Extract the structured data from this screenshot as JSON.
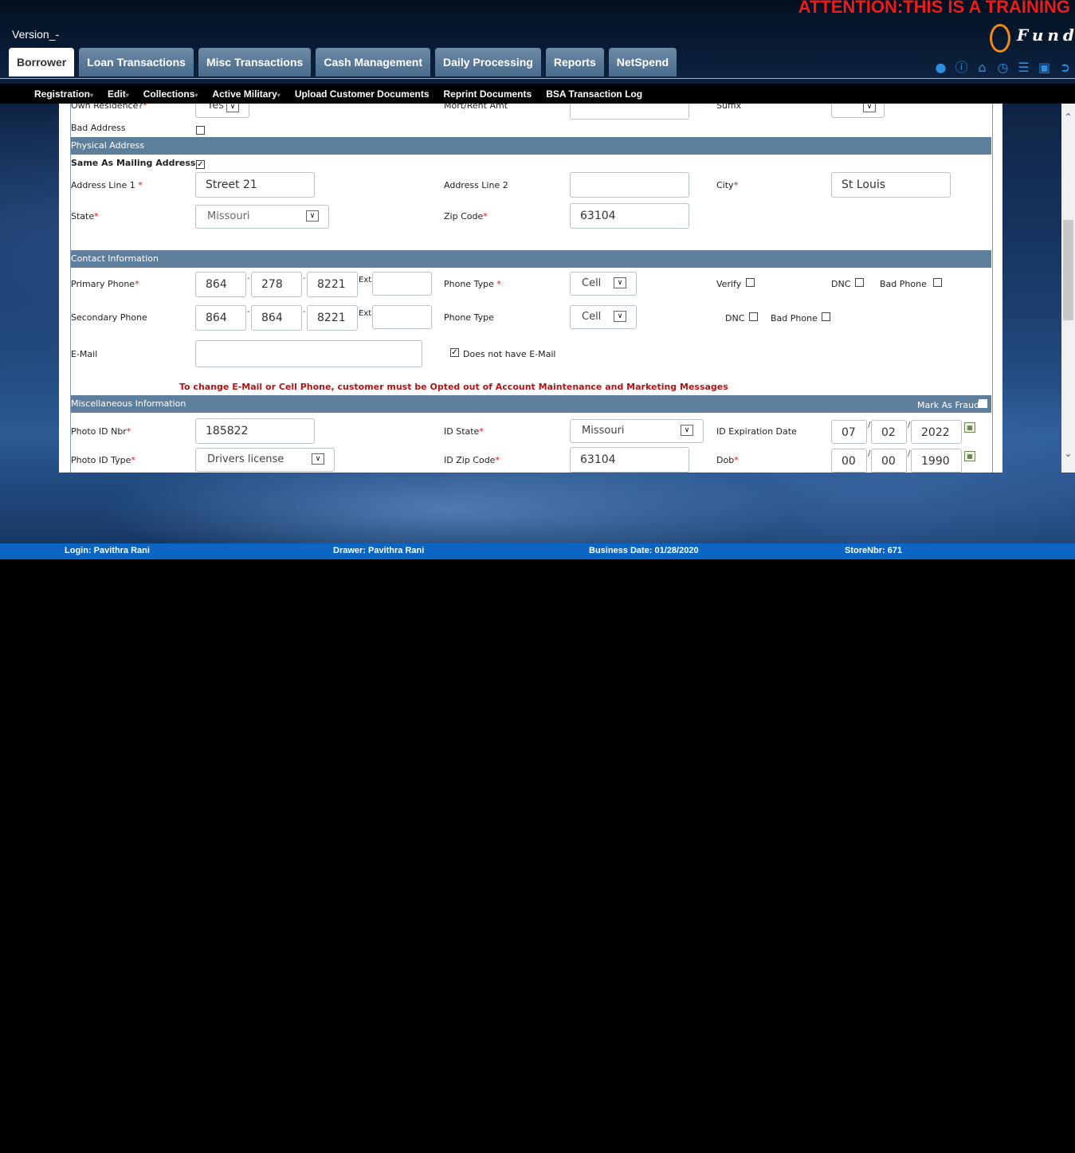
{
  "header": {
    "attention": "ATTENTION:THIS IS A TRAINING",
    "version": "Version_-",
    "logo_text": "Fund",
    "tabs": [
      "Borrower",
      "Loan Transactions",
      "Misc Transactions",
      "Cash Management",
      "Daily Processing",
      "Reports",
      "NetSpend"
    ],
    "active_tab": "Borrower",
    "icons": [
      "user-icon",
      "info-icon",
      "home-icon",
      "clock-icon",
      "list-icon",
      "lock-icon",
      "logout-icon"
    ]
  },
  "menu": {
    "items": [
      {
        "label": "Registration",
        "caret": true
      },
      {
        "label": "Edit",
        "caret": true
      },
      {
        "label": "Collections",
        "caret": true
      },
      {
        "label": "Active Military",
        "caret": true
      },
      {
        "label": "Upload Customer Documents",
        "caret": false
      },
      {
        "label": "Reprint Documents",
        "caret": false
      },
      {
        "label": "BSA Transaction Log",
        "caret": false
      }
    ]
  },
  "form": {
    "partial": {
      "own_residence_label": "Own Residence?",
      "own_residence_value": "Yes",
      "mort_rent_label": "Mort/Rent Amt",
      "suffix_label": "Suffix",
      "bad_address_label": "Bad Address"
    },
    "physical": {
      "title": "Physical Address",
      "same_as_label": "Same As Mailing Address",
      "address1_label": "Address Line 1",
      "address1_value": "Street 21",
      "address2_label": "Address Line 2",
      "address2_value": "",
      "city_label": "City",
      "city_value": "St Louis",
      "state_label": "State",
      "state_value": "Missouri",
      "zip_label": "Zip Code",
      "zip_value": "63104"
    },
    "contact": {
      "title": "Contact Information",
      "primary_label": "Primary Phone",
      "primary": [
        "864",
        "278",
        "8221"
      ],
      "secondary_label": "Secondary Phone",
      "secondary": [
        "864",
        "864",
        "8221"
      ],
      "ext_label": "Ext",
      "phone_type_label": "Phone Type",
      "phone_type_value": "Cell",
      "phone_type2_label": "Phone Type",
      "phone_type2_value": "Cell",
      "verify_label": "Verify",
      "dnc_label": "DNC",
      "bad_phone_label": "Bad Phone",
      "email_label": "E-Mail",
      "email_value": "",
      "no_email_label": "Does not have E-Mail",
      "warning": "To change E-Mail or Cell Phone, customer must be Opted out of Account Maintenance and Marketing Messages"
    },
    "misc": {
      "title": "Miscellaneous Information",
      "fraud_label": "Mark As Fraud",
      "photo_id_nbr_label": "Photo ID Nbr",
      "photo_id_nbr_value": "185822",
      "id_state_label": "ID State",
      "id_state_value": "Missouri",
      "id_exp_label": "ID Expiration Date",
      "id_exp": [
        "07",
        "02",
        "2022"
      ],
      "photo_id_type_label": "Photo ID Type",
      "photo_id_type_value": "Drivers license",
      "id_zip_label": "ID Zip Code",
      "id_zip_value": "63104",
      "dob_label": "Dob",
      "dob": [
        "00",
        "00",
        "1990"
      ]
    }
  },
  "status": {
    "login": "Login: Pavithra Rani",
    "drawer": "Drawer: Pavithra Rani",
    "business_date": "Business Date: 01/28/2020",
    "store": "StoreNbr: 671"
  }
}
